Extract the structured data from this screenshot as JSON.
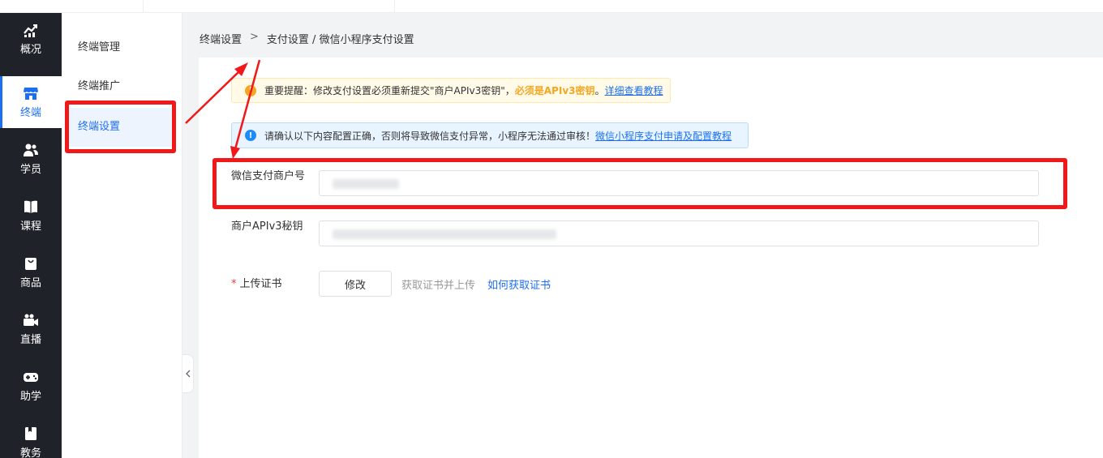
{
  "nav": {
    "items": [
      {
        "label": "概况",
        "icon": "chart-trend-icon"
      },
      {
        "label": "终端",
        "icon": "storefront-icon",
        "active": true
      },
      {
        "label": "学员",
        "icon": "users-icon"
      },
      {
        "label": "课程",
        "icon": "book-icon"
      },
      {
        "label": "商品",
        "icon": "bag-icon"
      },
      {
        "label": "直播",
        "icon": "video-camera-icon"
      },
      {
        "label": "助学",
        "icon": "gamepad-icon"
      },
      {
        "label": "教务",
        "icon": "clipboard-icon"
      }
    ]
  },
  "submenu": {
    "items": [
      {
        "label": "终端管理"
      },
      {
        "label": "终端推广"
      },
      {
        "label": "终端设置",
        "active": true
      }
    ]
  },
  "breadcrumb": {
    "root": "终端设置",
    "separator": ">",
    "current": "支付设置 / 微信小程序支付设置"
  },
  "alerts": {
    "warning": {
      "prefix": "重要提醒：修改支付设置必须重新提交\"商户APIv3密钥\"，",
      "emphasis": "必须是APIv3密钥",
      "suffix": "。",
      "link": "详细查看教程"
    },
    "info": {
      "text": "请确认以下内容配置正确，否则将导致微信支付异常，小程序无法通过审核！",
      "link": "微信小程序支付申请及配置教程"
    }
  },
  "form": {
    "merchant_id": {
      "label": "微信支付商户号",
      "value": ""
    },
    "api_key": {
      "label": "商户APIv3秘钥",
      "value": ""
    },
    "certificate": {
      "required_mark": "*",
      "label": "上传证书",
      "button": "修改",
      "hint": "获取证书并上传",
      "link": "如何获取证书"
    }
  },
  "colors": {
    "primary": "#1d6ff2",
    "nav_bg": "#1f2229",
    "annotation_red": "#f01818",
    "warning": "#f5a623",
    "info": "#1d8cf8"
  }
}
